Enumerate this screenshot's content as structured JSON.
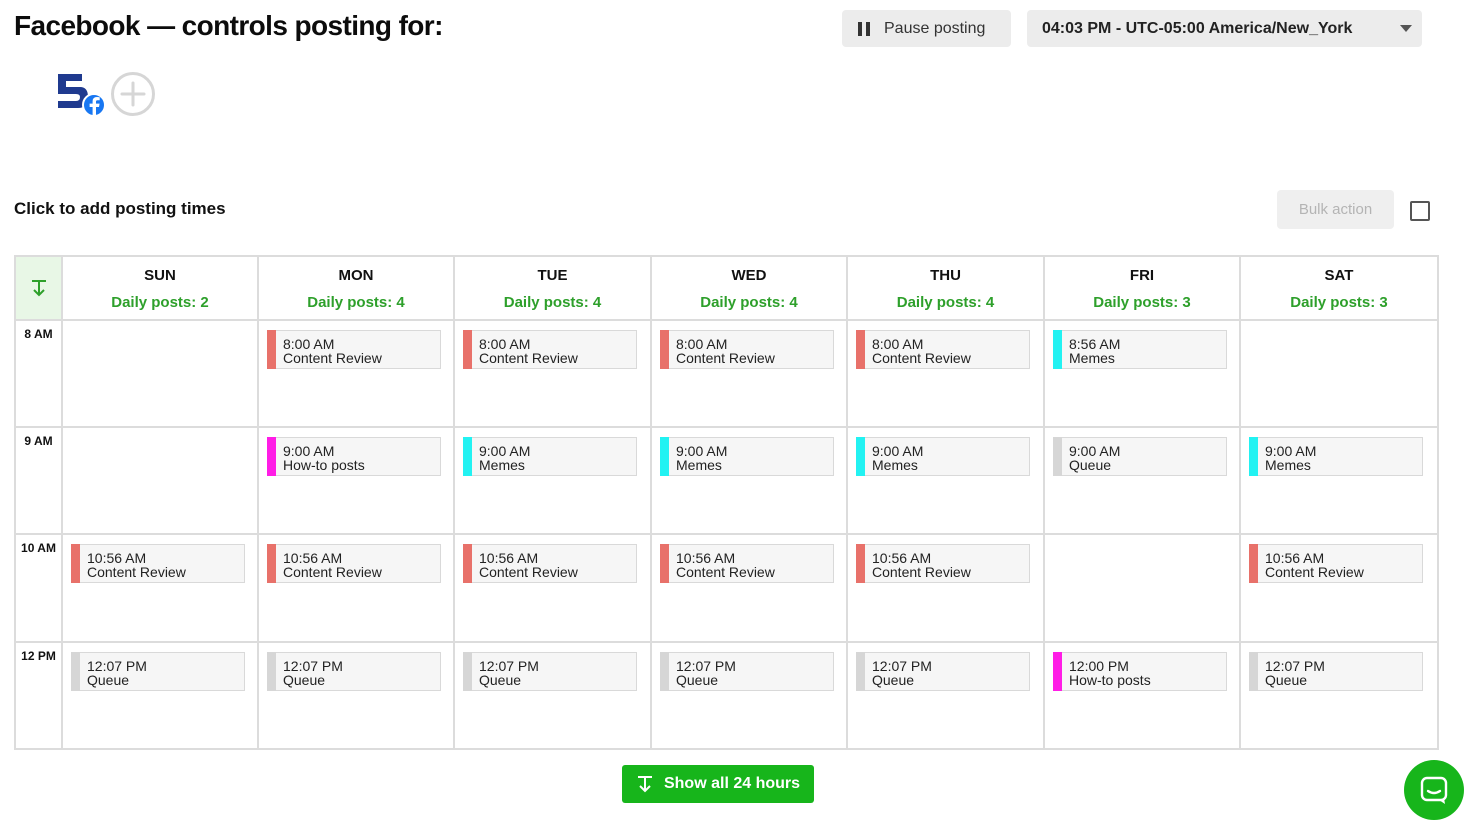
{
  "header": {
    "title": "Facebook — controls posting for:",
    "pause_label": "Pause posting",
    "timezone": "04:03 PM - UTC-05:00 America/New_York"
  },
  "subtitle": "Click to add posting times",
  "bulk_action_label": "Bulk action",
  "show_all_label": "Show all 24 hours",
  "colors": {
    "Content Review": "#e8716a",
    "How-to posts": "#ff1de6",
    "Memes": "#22f2f2",
    "Queue": "#d6d6d6",
    "accent_green": "#17b51b",
    "count_green": "#2ea02b"
  },
  "hours": [
    "8 AM",
    "9 AM",
    "10 AM",
    "12 PM"
  ],
  "days": [
    {
      "name": "SUN",
      "count": "Daily posts: 2",
      "slots": [
        null,
        null,
        {
          "time": "10:56 AM",
          "label": "Content Review"
        },
        {
          "time": "12:07 PM",
          "label": "Queue"
        }
      ]
    },
    {
      "name": "MON",
      "count": "Daily posts: 4",
      "slots": [
        {
          "time": "8:00 AM",
          "label": "Content Review"
        },
        {
          "time": "9:00 AM",
          "label": "How-to posts"
        },
        {
          "time": "10:56 AM",
          "label": "Content Review"
        },
        {
          "time": "12:07 PM",
          "label": "Queue"
        }
      ]
    },
    {
      "name": "TUE",
      "count": "Daily posts: 4",
      "slots": [
        {
          "time": "8:00 AM",
          "label": "Content Review"
        },
        {
          "time": "9:00 AM",
          "label": "Memes"
        },
        {
          "time": "10:56 AM",
          "label": "Content Review"
        },
        {
          "time": "12:07 PM",
          "label": "Queue"
        }
      ]
    },
    {
      "name": "WED",
      "count": "Daily posts: 4",
      "slots": [
        {
          "time": "8:00 AM",
          "label": "Content Review"
        },
        {
          "time": "9:00 AM",
          "label": "Memes"
        },
        {
          "time": "10:56 AM",
          "label": "Content Review"
        },
        {
          "time": "12:07 PM",
          "label": "Queue"
        }
      ]
    },
    {
      "name": "THU",
      "count": "Daily posts: 4",
      "slots": [
        {
          "time": "8:00 AM",
          "label": "Content Review"
        },
        {
          "time": "9:00 AM",
          "label": "Memes"
        },
        {
          "time": "10:56 AM",
          "label": "Content Review"
        },
        {
          "time": "12:07 PM",
          "label": "Queue"
        }
      ]
    },
    {
      "name": "FRI",
      "count": "Daily posts: 3",
      "slots": [
        {
          "time": "8:56 AM",
          "label": "Memes"
        },
        {
          "time": "9:00 AM",
          "label": "Queue"
        },
        null,
        {
          "time": "12:00 PM",
          "label": "How-to posts"
        }
      ]
    },
    {
      "name": "SAT",
      "count": "Daily posts: 3",
      "slots": [
        null,
        {
          "time": "9:00 AM",
          "label": "Memes"
        },
        {
          "time": "10:56 AM",
          "label": "Content Review"
        },
        {
          "time": "12:07 PM",
          "label": "Queue"
        }
      ]
    }
  ],
  "icons": {
    "pause": "pause-icon",
    "caret": "chevron-down-icon",
    "expand": "expand-down-icon",
    "add_account": "plus-circle-icon",
    "chat": "chat-icon"
  }
}
